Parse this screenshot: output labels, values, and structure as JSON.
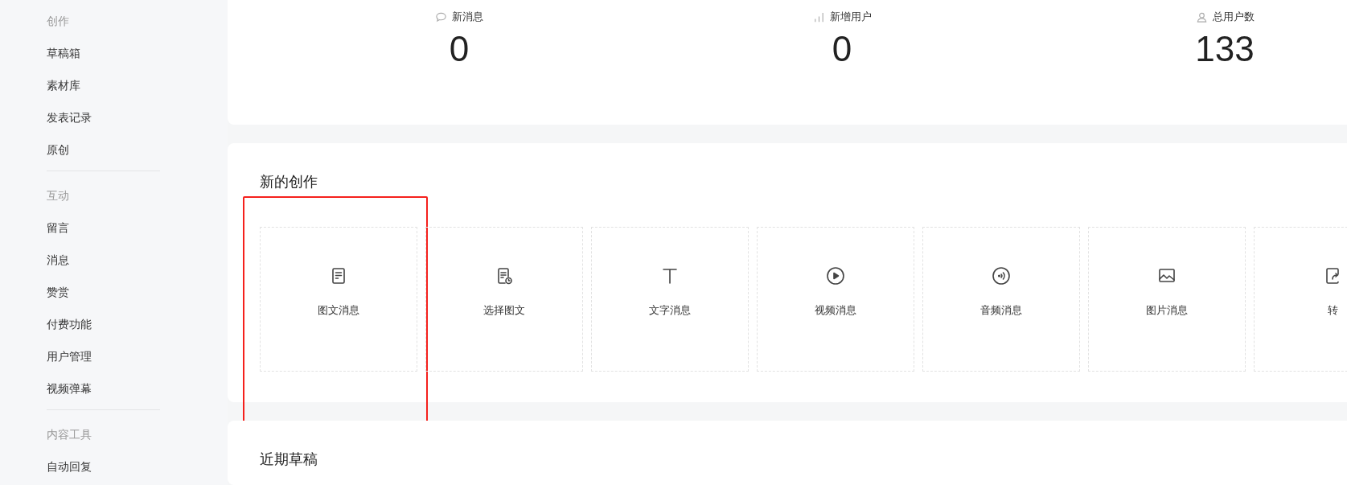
{
  "sidebar": {
    "groups": [
      {
        "title": "创作",
        "items": [
          "草稿箱",
          "素材库",
          "发表记录",
          "原创"
        ]
      },
      {
        "title": "互动",
        "items": [
          "留言",
          "消息",
          "赞赏",
          "付费功能",
          "用户管理",
          "视频弹幕"
        ]
      },
      {
        "title": "内容工具",
        "items": [
          "自动回复"
        ]
      }
    ]
  },
  "stats": [
    {
      "kind": "messages",
      "label": "新消息",
      "value": "0"
    },
    {
      "kind": "new_users",
      "label": "新增用户",
      "value": "0"
    },
    {
      "kind": "total_users",
      "label": "总用户数",
      "value": "133"
    }
  ],
  "creation": {
    "title": "新的创作",
    "tiles": [
      {
        "kind": "article",
        "label": "图文消息",
        "highlighted": true
      },
      {
        "kind": "pick",
        "label": "选择图文",
        "highlighted": false
      },
      {
        "kind": "text",
        "label": "文字消息",
        "highlighted": false
      },
      {
        "kind": "video",
        "label": "视频消息",
        "highlighted": false
      },
      {
        "kind": "audio",
        "label": "音频消息",
        "highlighted": false
      },
      {
        "kind": "image",
        "label": "图片消息",
        "highlighted": false
      },
      {
        "kind": "repost",
        "label": "转",
        "highlighted": false
      }
    ]
  },
  "drafts": {
    "title": "近期草稿"
  }
}
